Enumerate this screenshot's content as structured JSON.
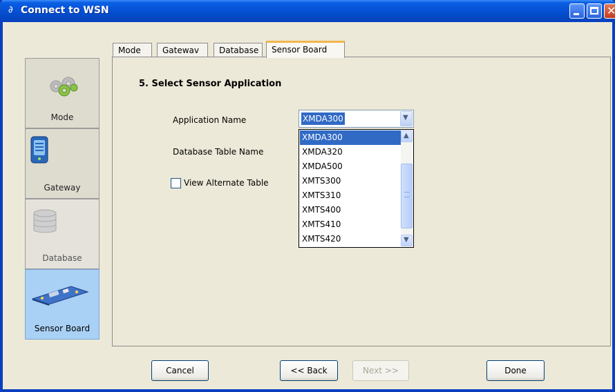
{
  "window": {
    "title": "Connect to WSN"
  },
  "nav": {
    "items": [
      {
        "label": "Mode",
        "icon": "gears-icon",
        "state": "normal"
      },
      {
        "label": "Gateway",
        "icon": "gateway-server-icon",
        "state": "normal"
      },
      {
        "label": "Database",
        "icon": "database-icon",
        "state": "disabled"
      },
      {
        "label": "Sensor Board",
        "icon": "sensor-board-icon",
        "state": "active"
      }
    ]
  },
  "tabs": [
    {
      "label": "Mode"
    },
    {
      "label": "Gatewav"
    },
    {
      "label": "Database"
    },
    {
      "label": "Sensor Board",
      "active": true
    }
  ],
  "panel": {
    "step_title": "5. Select Sensor Application",
    "application_name_label": "Application Name",
    "database_table_label": "Database Table Name",
    "view_alternate_label": "View Alternate Table",
    "view_alternate_checked": false,
    "application_value": "XMDA300",
    "application_options": [
      "XMDA300",
      "XMDA320",
      "XMDA500",
      "XMTS300",
      "XMTS310",
      "XMTS400",
      "XMTS410",
      "XMTS420"
    ],
    "selected_index": 0
  },
  "buttons": {
    "cancel": "Cancel",
    "back": "<< Back",
    "next": "Next >>",
    "done": "Done"
  },
  "colors": {
    "titlebar": "#0550d4",
    "selection": "#316ac5",
    "active_tab_accent": "#f2b64b",
    "active_nav": "#a9d0f5"
  }
}
